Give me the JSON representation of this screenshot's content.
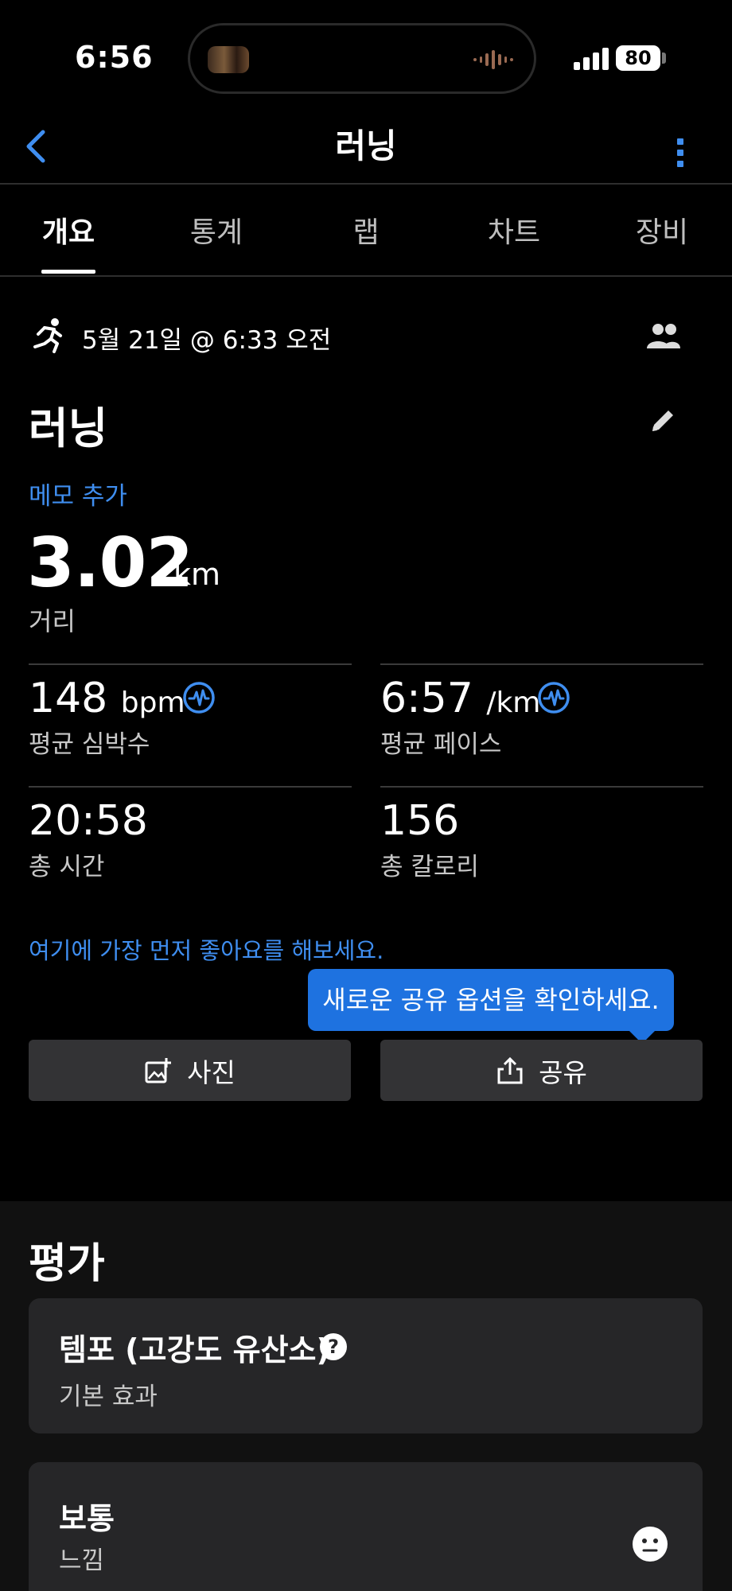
{
  "status_bar": {
    "time": "6:56",
    "battery": "80"
  },
  "header": {
    "title": "러닝"
  },
  "tabs": [
    {
      "label": "개요",
      "active": true
    },
    {
      "label": "통계",
      "active": false
    },
    {
      "label": "랩",
      "active": false
    },
    {
      "label": "차트",
      "active": false
    },
    {
      "label": "장비",
      "active": false
    }
  ],
  "activity": {
    "date": "5월 21일 @ 6:33 오전",
    "title": "러닝",
    "memo_link": "메모 추가"
  },
  "distance": {
    "value": "3.02",
    "unit": "km",
    "label": "거리"
  },
  "stats": {
    "avg_hr": {
      "value": "148",
      "unit": "bpm",
      "label": "평균 심박수"
    },
    "avg_pace": {
      "value": "6:57",
      "unit": "/km",
      "label": "평균 페이스"
    },
    "total_time": {
      "value": "20:58",
      "label": "총 시간"
    },
    "total_calories": {
      "value": "156",
      "label": "총 칼로리"
    }
  },
  "like_link": "여기에 가장 먼저 좋아요를 해보세요.",
  "tooltip": "새로운 공유 옵션을 확인하세요.",
  "actions": {
    "photo": "사진",
    "share": "공유"
  },
  "evaluation": {
    "title": "평가",
    "training_effect": {
      "title": "템포 (고강도 유산소)",
      "subtitle": "기본 효과"
    },
    "feel": {
      "title": "보통",
      "subtitle": "느낌"
    }
  },
  "colors": {
    "accent": "#3f8ef0",
    "tooltip": "#1e72e0",
    "button_bg": "#333335",
    "card_bg": "#262628"
  }
}
